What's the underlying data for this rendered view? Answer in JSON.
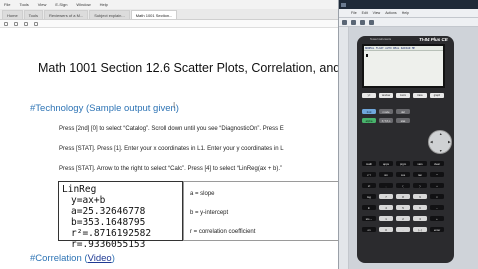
{
  "viewer": {
    "menu": [
      "File",
      "Tools",
      "View",
      "E-Sign",
      "Window",
      "Help"
    ],
    "tabs": [
      {
        "label": "Home",
        "active": false
      },
      {
        "label": "Tools",
        "active": false
      },
      {
        "label": "Reviewers of a M...",
        "active": false
      },
      {
        "label": "Subject explain...",
        "active": false
      },
      {
        "label": "Math 1001 Section...",
        "active": true
      }
    ]
  },
  "document": {
    "title": "Math 1001 Section 12.6 Scatter Plots, Correlation, and",
    "tech_heading": "#Technology (",
    "tech_link": "Sample output given",
    "tech_heading_end": ")",
    "para1": "Press [2nd] [0] to select “Catalog”. Scroll down until you see “DiagnosticOn”. Press E",
    "para2": "Press [STAT]. Press [1].  Enter your x coordinates in L1. Enter your y coordinates in L",
    "para3": "Press [STAT]. Arrow to the right to select “Calc”. Press [4] to select “LinReg(ax + b).”",
    "calc_output": {
      "line1": "LinReg",
      "line2": "y=ax+b",
      "line3": "a=25.32646778",
      "line4": "b=353.1648795",
      "line5": "r²=.8716192582",
      "line6": "r=.9336055153"
    },
    "definitions": {
      "a": "a = slope",
      "b": "b = y-intercept",
      "r": "r = correlation coefficient"
    },
    "corr_heading": "#Correlation (",
    "corr_link": "Video",
    "corr_heading_end": ")"
  },
  "emulator": {
    "menu": [
      "File",
      "Edit",
      "View",
      "Actions",
      "Help"
    ],
    "brand": "Texas Instruments",
    "model": "TI-84 Plus CE",
    "status": "NORMAL FLOAT AUTO REAL RADIAN MP",
    "fkeys": [
      "y=",
      "window",
      "zoom",
      "trace",
      "graph"
    ],
    "rows": [
      [
        {
          "label": "2nd",
          "style": "blue"
        },
        {
          "label": "mode",
          "style": "gray"
        },
        {
          "label": "del",
          "style": "gray"
        }
      ],
      [
        {
          "label": "alpha",
          "style": "green"
        },
        {
          "label": "X,T,θ,n",
          "style": "gray"
        },
        {
          "label": "stat",
          "style": "gray"
        }
      ],
      [
        {
          "label": "math",
          "style": ""
        },
        {
          "label": "apps",
          "style": ""
        },
        {
          "label": "prgm",
          "style": ""
        },
        {
          "label": "vars",
          "style": ""
        },
        {
          "label": "clear",
          "style": ""
        }
      ],
      [
        {
          "label": "x⁻¹",
          "style": ""
        },
        {
          "label": "sin",
          "style": ""
        },
        {
          "label": "cos",
          "style": ""
        },
        {
          "label": "tan",
          "style": ""
        },
        {
          "label": "^",
          "style": ""
        }
      ],
      [
        {
          "label": "x²",
          "style": ""
        },
        {
          "label": ",",
          "style": ""
        },
        {
          "label": "(",
          "style": ""
        },
        {
          "label": ")",
          "style": ""
        },
        {
          "label": "÷",
          "style": ""
        }
      ],
      [
        {
          "label": "log",
          "style": ""
        },
        {
          "label": "7",
          "style": "white"
        },
        {
          "label": "8",
          "style": "white"
        },
        {
          "label": "9",
          "style": "white"
        },
        {
          "label": "×",
          "style": ""
        }
      ],
      [
        {
          "label": "ln",
          "style": ""
        },
        {
          "label": "4",
          "style": "white"
        },
        {
          "label": "5",
          "style": "white"
        },
        {
          "label": "6",
          "style": "white"
        },
        {
          "label": "−",
          "style": ""
        }
      ],
      [
        {
          "label": "sto→",
          "style": ""
        },
        {
          "label": "1",
          "style": "white"
        },
        {
          "label": "2",
          "style": "white"
        },
        {
          "label": "3",
          "style": "white"
        },
        {
          "label": "+",
          "style": ""
        }
      ],
      [
        {
          "label": "on",
          "style": ""
        },
        {
          "label": "0",
          "style": "white"
        },
        {
          "label": ".",
          "style": "white"
        },
        {
          "label": "(−)",
          "style": "white"
        },
        {
          "label": "enter",
          "style": ""
        }
      ]
    ]
  }
}
